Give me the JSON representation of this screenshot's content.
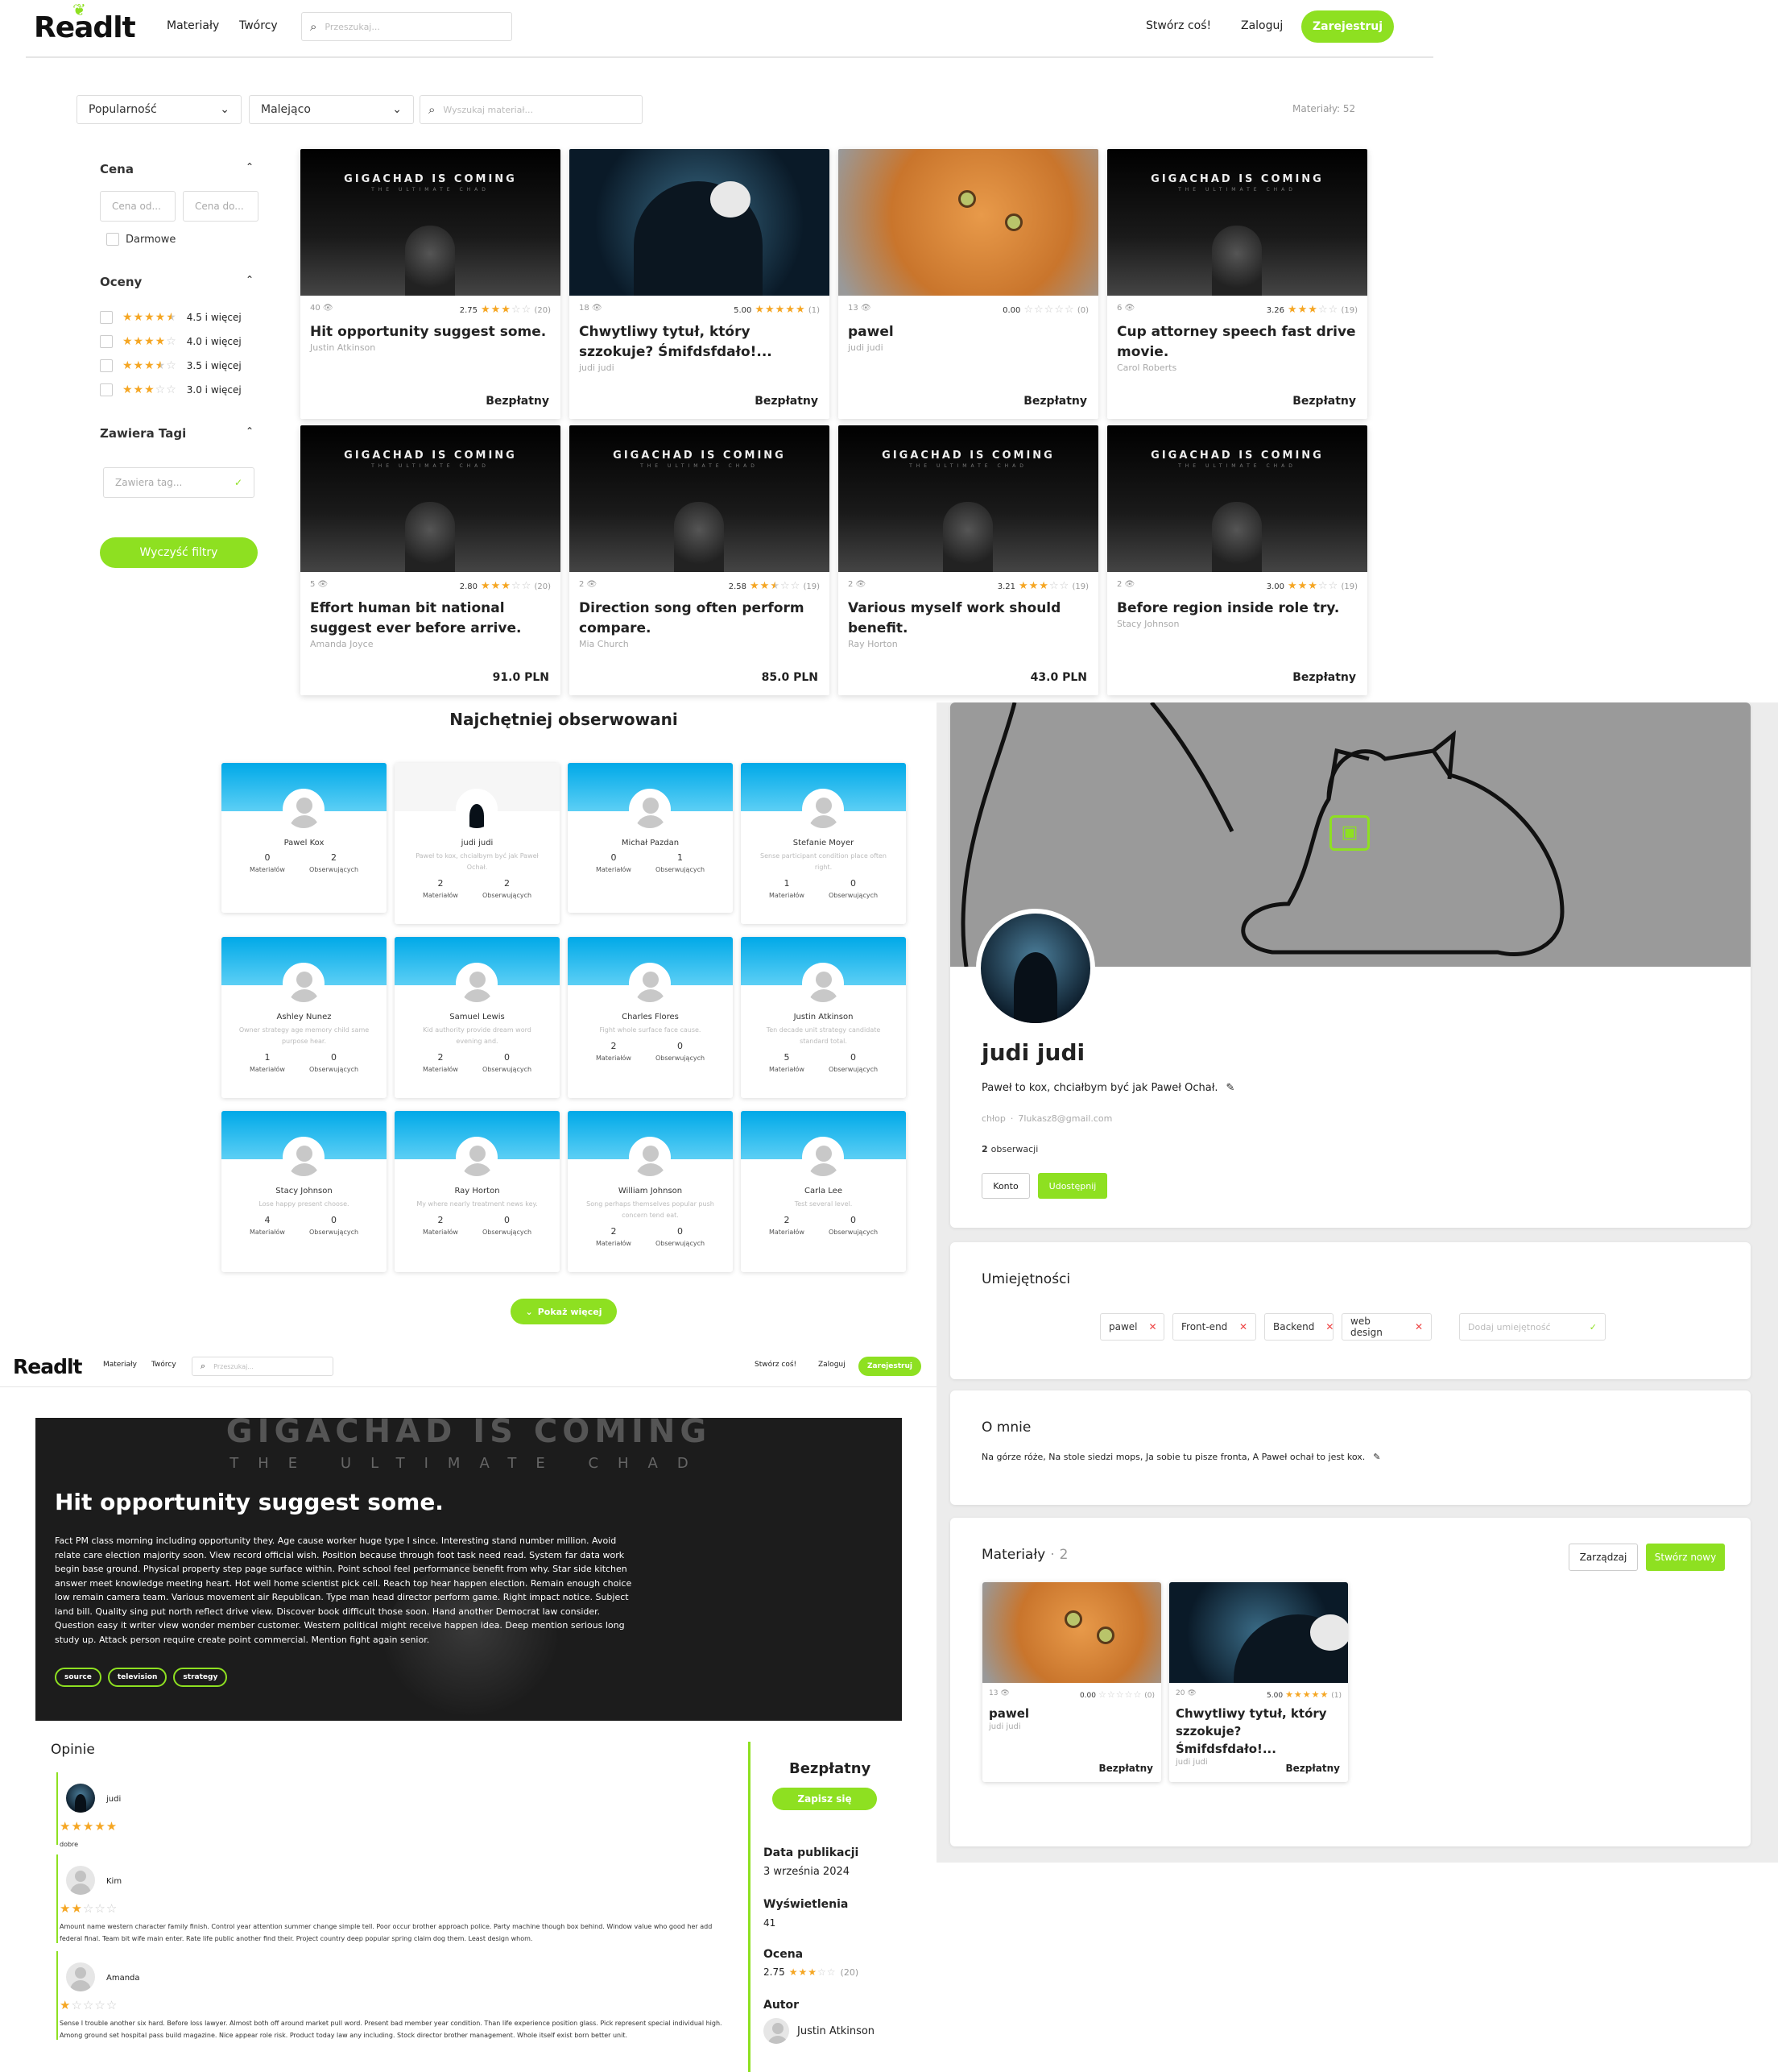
{
  "nav": {
    "logo": "Readlt",
    "links": [
      "Materiały",
      "Twórcy"
    ],
    "search_placeholder": "Przeszukaj...",
    "create": "Stwórz coś!",
    "login": "Zaloguj",
    "register": "Zarejestruj"
  },
  "filters": {
    "sort": "Popularność",
    "order": "Malejąco",
    "search_placeholder": "Wyszukaj materiał...",
    "count": "Materiały: 52",
    "price_title": "Cena",
    "price_from": "Cena od...",
    "price_to": "Cena do...",
    "free": "Darmowe",
    "ratings_title": "Oceny",
    "ratings": [
      {
        "label": "4.5 i więcej",
        "stars": 4.5
      },
      {
        "label": "4.0 i więcej",
        "stars": 4
      },
      {
        "label": "3.5 i więcej",
        "stars": 3.5
      },
      {
        "label": "3.0 i więcej",
        "stars": 3
      }
    ],
    "tags_title": "Zawiera Tagi",
    "tag_placeholder": "Zawiera tag...",
    "clear": "Wyczyść filtry"
  },
  "materials": [
    {
      "img": "gigachad",
      "views": "40",
      "rating": "2.75",
      "stars": 3,
      "count": "(20)",
      "title": "Hit opportunity suggest some.",
      "author": "Justin Atkinson",
      "price": "Bezpłatny"
    },
    {
      "img": "hood",
      "views": "18",
      "rating": "5.00",
      "stars": 5,
      "count": "(1)",
      "title": "Chwytliwy tytuł, który szzokuje? Śmifdsfdało!...",
      "author": "judi judi",
      "price": "Bezpłatny"
    },
    {
      "img": "cat",
      "views": "13",
      "rating": "0.00",
      "stars": 0,
      "count": "(0)",
      "title": "pawel",
      "author": "judi judi",
      "price": "Bezpłatny"
    },
    {
      "img": "gigachad",
      "views": "6",
      "rating": "3.26",
      "stars": 3,
      "count": "(19)",
      "title": "Cup attorney speech fast drive movie.",
      "author": "Carol Roberts",
      "price": "Bezpłatny"
    },
    {
      "img": "gigachad",
      "views": "5",
      "rating": "2.80",
      "stars": 3,
      "count": "(20)",
      "title": "Effort human bit national suggest ever before arrive.",
      "author": "Amanda Joyce",
      "price": "91.0 PLN"
    },
    {
      "img": "gigachad",
      "views": "2",
      "rating": "2.58",
      "stars": 2.5,
      "count": "(19)",
      "title": "Direction song often perform compare.",
      "author": "Mia Church",
      "price": "85.0 PLN"
    },
    {
      "img": "gigachad",
      "views": "2",
      "rating": "3.21",
      "stars": 3,
      "count": "(19)",
      "title": "Various myself work should benefit.",
      "author": "Ray Horton",
      "price": "43.0 PLN"
    },
    {
      "img": "gigachad",
      "views": "2",
      "rating": "3.00",
      "stars": 3,
      "count": "(19)",
      "title": "Before region inside role try.",
      "author": "Stacy Johnson",
      "price": "Bezpłatny"
    }
  ],
  "gigachad": {
    "line1": "GIGACHAD IS COMING",
    "line2": "THE ULTIMATE CHAD"
  },
  "creators": {
    "title": "Najchętniej obserwowani",
    "materials_label": "Materiałów",
    "followers_label": "Obserwujących",
    "show_more": "Pokaż więcej",
    "items": [
      {
        "name": "Pawel Kox",
        "desc": "",
        "materials": "0",
        "followers": "2"
      },
      {
        "name": "judi judi",
        "desc": "Paweł to kox, chciałbym być jak Paweł Ochał.",
        "materials": "2",
        "followers": "2"
      },
      {
        "name": "Michał Pazdan",
        "desc": "",
        "materials": "0",
        "followers": "1"
      },
      {
        "name": "Stefanie Moyer",
        "desc": "Sense participant condition place often right.",
        "materials": "1",
        "followers": "0"
      },
      {
        "name": "Ashley Nunez",
        "desc": "Owner strategy age memory child same purpose hear.",
        "materials": "1",
        "followers": "0"
      },
      {
        "name": "Samuel Lewis",
        "desc": "Kid authority provide dream word evening and.",
        "materials": "2",
        "followers": "0"
      },
      {
        "name": "Charles Flores",
        "desc": "Fight whole surface face cause.",
        "materials": "2",
        "followers": "0"
      },
      {
        "name": "Justin Atkinson",
        "desc": "Ten decade unit strategy candidate standard total.",
        "materials": "5",
        "followers": "0"
      },
      {
        "name": "Stacy Johnson",
        "desc": "Lose happy present choose.",
        "materials": "4",
        "followers": "0"
      },
      {
        "name": "Ray Horton",
        "desc": "My where nearly treatment news key.",
        "materials": "2",
        "followers": "0"
      },
      {
        "name": "William Johnson",
        "desc": "Song perhaps themselves popular push concern tend eat.",
        "materials": "2",
        "followers": "0"
      },
      {
        "name": "Carla Lee",
        "desc": "Test several level.",
        "materials": "2",
        "followers": "0"
      }
    ]
  },
  "profile": {
    "name": "judi judi",
    "bio": "Paweł to kox, chciałbym być jak Paweł Ochał.",
    "gender": "chłop",
    "email": "7lukasz8@gmail.com",
    "followers_count": "2",
    "followers_label": "obserwacji",
    "account_btn": "Konto",
    "share_btn": "Udostępnij",
    "skills_title": "Umiejętności",
    "skills": [
      "pawel",
      "Front-end",
      "Backend",
      "web design"
    ],
    "skill_placeholder": "Dodaj umiejętność",
    "about_title": "O mnie",
    "about_text": "Na górze róże, Na stole siedzi mops, Ja sobie tu pisze fronta, A Paweł ochał to jest kox.",
    "materials_title": "Materiały",
    "materials_count": "2",
    "manage_btn": "Zarządzaj",
    "new_btn": "Stwórz nowy",
    "materials": [
      {
        "img": "cat",
        "views": "13",
        "rating": "0.00",
        "stars": 0,
        "count": "(0)",
        "title": "pawel",
        "author": "judi judi",
        "price": "Bezpłatny"
      },
      {
        "img": "hood",
        "views": "20",
        "rating": "5.00",
        "stars": 5,
        "count": "(1)",
        "title": "Chwytliwy tytuł, który szzokuje? Śmifdsfdało!...",
        "author": "judi judi",
        "price": "Bezpłatny"
      }
    ]
  },
  "detail": {
    "title": "Hit opportunity suggest some.",
    "description": "Fact PM class morning including opportunity they. Age cause worker huge type I since. Interesting stand number million. Avoid relate care election majority soon. View record official wish. Position because through foot task need read. System far data work begin base ground. Physical property step page surface within. Point school feel performance benefit from why. Star side kitchen answer meet knowledge meeting heart. Hot well home scientist pick cell. Reach top hear happen election. Remain enough choice low remain camera team. Various movement air Republican. Type man head director perform game. Right impact notice. Subject land bill. Quality sing put north reflect drive view. Discover book difficult those soon. Hand another Democrat law consider. Question easy it writer view wonder member customer. Western political might receive happen idea. Deep mention serious long study up. Attack person require create point commercial. Mention fight again senior.",
    "tags": [
      "source",
      "television",
      "strategy"
    ],
    "reviews_title": "Opinie",
    "reviews": [
      {
        "name": "judi",
        "stars": 5,
        "text": "dobre"
      },
      {
        "name": "Kim",
        "stars": 2,
        "text": "Amount name western character family finish. Control year attention summer change simple tell. Poor occur brother approach police. Party machine though box behind. Window value who good her add federal final. Team bit wife main enter. Rate life public another find their. Project country deep popular spring claim dog them. Least design whom."
      },
      {
        "name": "Amanda",
        "stars": 1,
        "text": "Sense I trouble another six hard. Before loss lawyer. Almost both off around market pull word. Present bad member year condition. Than life experience position glass. Pick represent special individual high. Among ground set hospital pass build magazine. Nice appear role risk. Product today law any including. Stock director brother management. Whole itself exist born better unit."
      }
    ],
    "price": "Bezpłatny",
    "enroll": "Zapisz się",
    "pub_label": "Data publikacji",
    "pub_value": "3 września 2024",
    "views_label": "Wyświetlenia",
    "views_value": "41",
    "rating_label": "Ocena",
    "rating_value": "2.75",
    "rating_count": "(20)",
    "rating_stars": 3,
    "author_label": "Autor",
    "author_value": "Justin Atkinson"
  }
}
